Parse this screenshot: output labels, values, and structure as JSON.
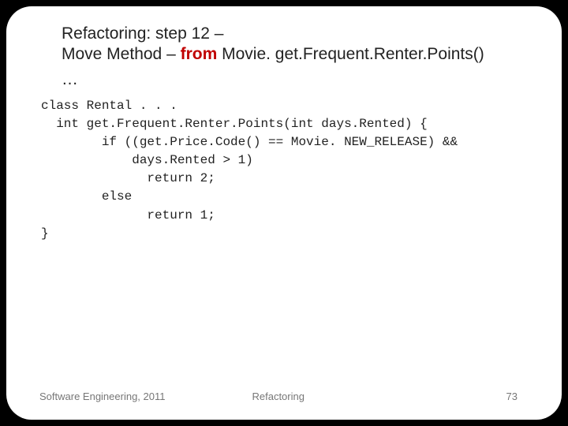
{
  "title": {
    "line1": "Refactoring: step 12 –",
    "line2_pre": "Move Method – ",
    "line2_from": "from",
    "line2_post": " Movie. get.Frequent.Renter.Points()"
  },
  "ellipsis": "…",
  "code": "class Rental . . .\n  int get.Frequent.Renter.Points(int days.Rented) {\n        if ((get.Price.Code() == Movie. NEW_RELEASE) &&\n            days.Rented > 1)\n              return 2;\n        else\n              return 1;\n}",
  "footer": {
    "left": "Software Engineering, 2011",
    "mid": "Refactoring",
    "page": "73"
  }
}
